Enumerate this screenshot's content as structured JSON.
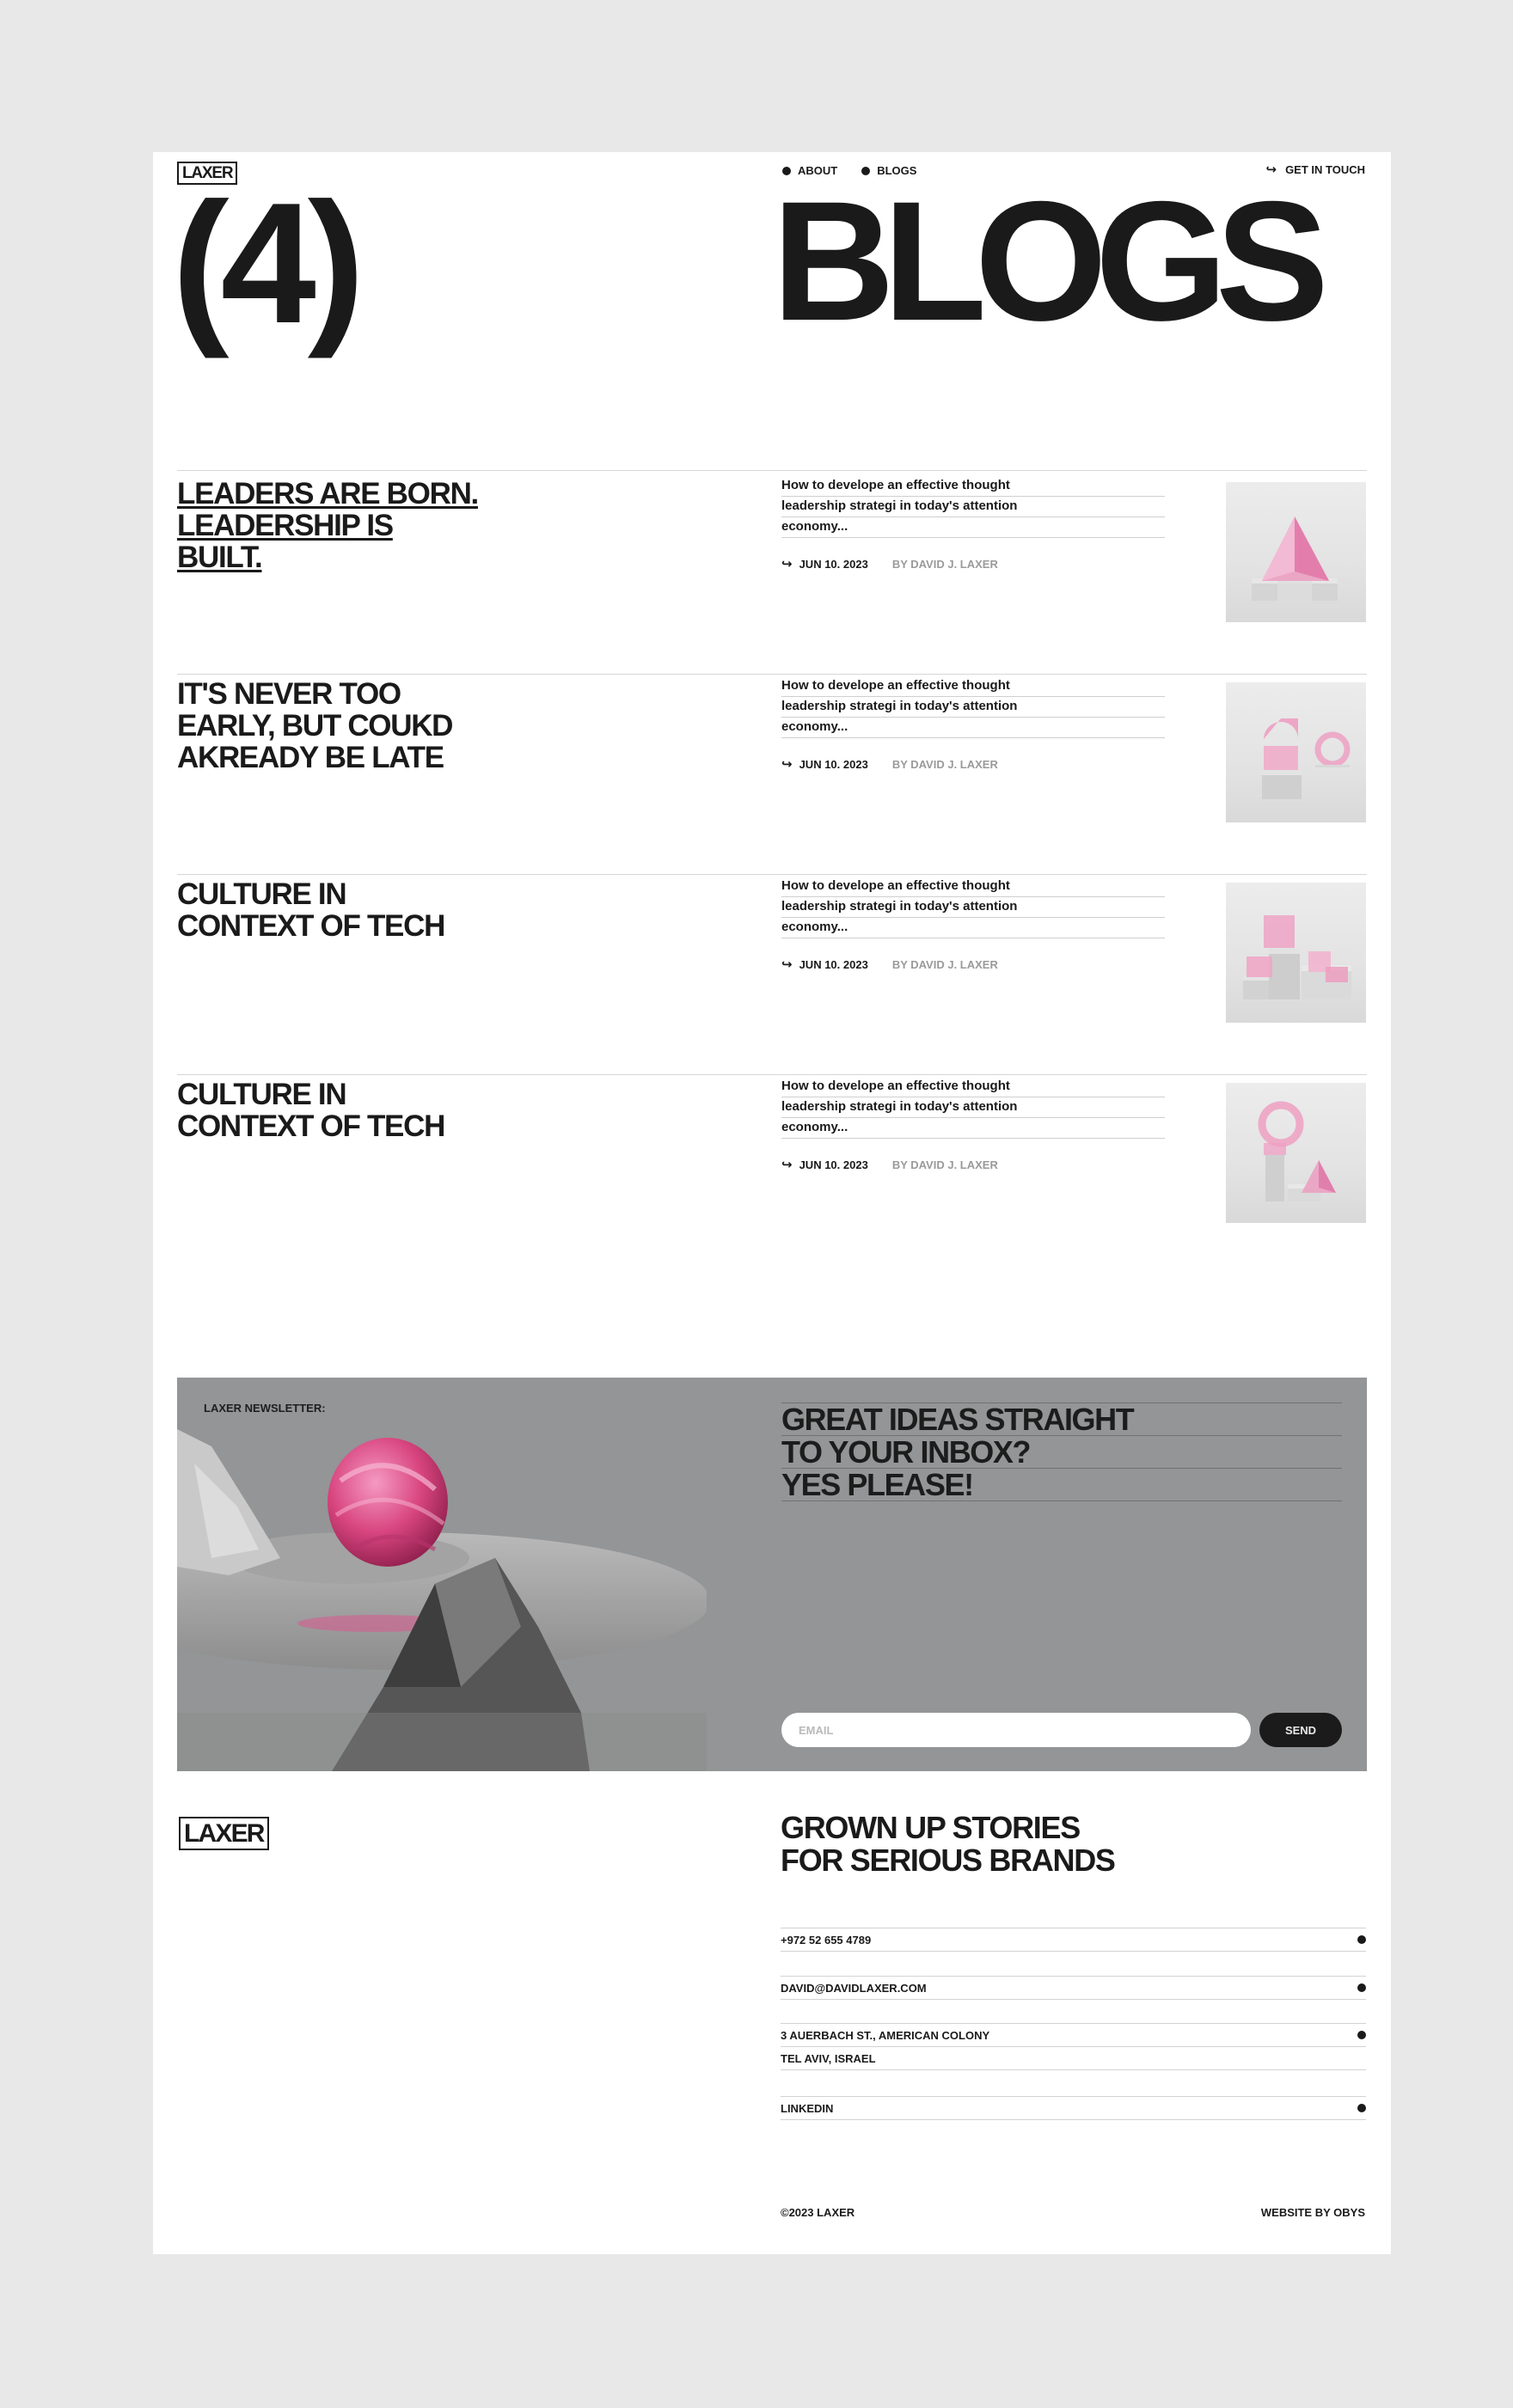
{
  "header": {
    "logo": "LAXER",
    "nav": [
      {
        "label": "ABOUT"
      },
      {
        "label": "BLOGS"
      }
    ],
    "cta": "GET IN TOUCH",
    "count": "(4)",
    "title": "BLOGS"
  },
  "blogs": [
    {
      "title_lines": [
        "LEADERS ARE BORN.",
        "LEADERSHIP IS",
        "BUILT."
      ],
      "excerpt_lines": [
        "How to develope an effective thought",
        "leadership strategi in today's attention",
        "economy..."
      ],
      "date": "JUN 10. 2023",
      "author": "BY DAVID J. LAXER",
      "image_icon": "pink-glass-pyramid-image"
    },
    {
      "title_lines": [
        "IT'S NEVER TOO",
        "EARLY, BUT COUKD",
        "AKREADY BE LATE"
      ],
      "excerpt_lines": [
        "How to develope an effective thought",
        "leadership strategi in today's attention",
        "economy..."
      ],
      "date": "JUN 10. 2023",
      "author": "BY DAVID J. LAXER",
      "image_icon": "pink-glass-shapes-stack-image"
    },
    {
      "title_lines": [
        "CULTURE IN",
        "CONTEXT OF TECH"
      ],
      "excerpt_lines": [
        "How to develope an effective thought",
        "leadership strategi in today's attention",
        "economy..."
      ],
      "date": "JUN 10. 2023",
      "author": "BY DAVID J. LAXER",
      "image_icon": "pink-glass-cubes-image"
    },
    {
      "title_lines": [
        "CULTURE IN",
        "CONTEXT OF TECH"
      ],
      "excerpt_lines": [
        "How to develope an effective thought",
        "leadership strategi in today's attention",
        "economy..."
      ],
      "date": "JUN 10. 2023",
      "author": "BY DAVID J. LAXER",
      "image_icon": "pink-glass-ring-tower-image"
    }
  ],
  "newsletter": {
    "label": "LAXER NEWSLETTER:",
    "headline_lines": [
      "GREAT IDEAS STRAIGHT",
      "TO YOUR INBOX?",
      "YES PLEASE!"
    ],
    "email_placeholder": "EMAIL",
    "send_label": "SEND",
    "art_icon": "pink-sphere-on-rock-platform-image"
  },
  "footer": {
    "logo": "LAXER",
    "title_lines": [
      "GROWN UP STORIES",
      "FOR SERIOUS BRANDS"
    ],
    "phone": "+972 52 655 4789",
    "email": "DAVID@DAVIDLAXER.COM",
    "address_lines": [
      "3 AUERBACH ST., AMERICAN COLONY",
      "TEL AVIV, ISRAEL"
    ],
    "linkedin": "LINKEDIN",
    "copyright": "©2023 LAXER",
    "credit": "WEBSITE BY OBYS"
  },
  "colors": {
    "ink": "#1a1a1a",
    "accent_pink": "#e879a8",
    "newsletter_bg": "#939596",
    "outer_bg": "#e8e8e8"
  }
}
